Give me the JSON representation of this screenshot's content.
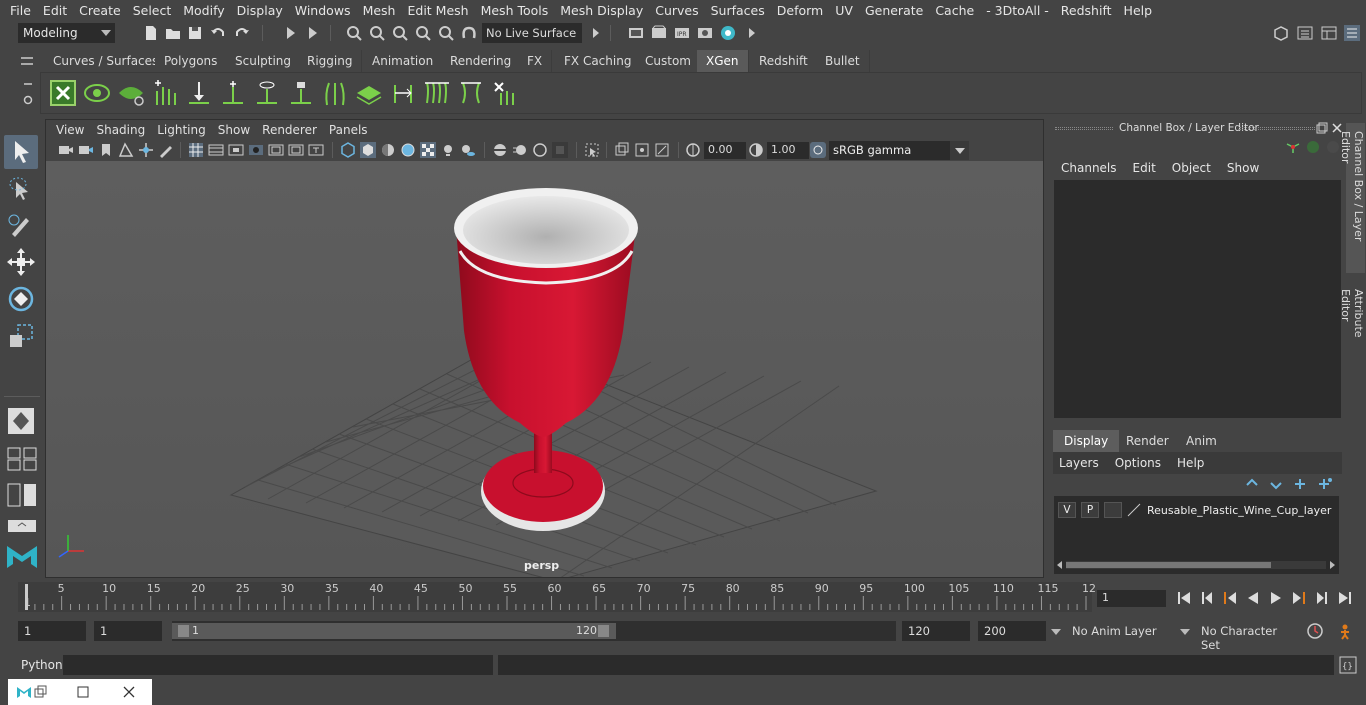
{
  "menubar": {
    "items": [
      "File",
      "Edit",
      "Create",
      "Select",
      "Modify",
      "Display",
      "Windows",
      "Mesh",
      "Edit Mesh",
      "Mesh Tools",
      "Mesh Display",
      "Curves",
      "Surfaces",
      "Deform",
      "UV",
      "Generate",
      "Cache",
      "- 3DtoAll -",
      "Redshift",
      "Help"
    ]
  },
  "statusline": {
    "mode": "Modeling",
    "live_surface": "No Live Surface"
  },
  "shelf": {
    "tabs": [
      "Curves / Surfaces",
      "Polygons",
      "Sculpting",
      "Rigging",
      "Animation",
      "Rendering",
      "FX",
      "FX Caching",
      "Custom",
      "XGen",
      "Redshift",
      "Bullet"
    ],
    "active_tab": "XGen"
  },
  "viewport": {
    "menus": [
      "View",
      "Shading",
      "Lighting",
      "Show",
      "Renderer",
      "Panels"
    ],
    "exposure": "0.00",
    "gamma": "1.00",
    "color_space": "sRGB gamma",
    "camera": "persp"
  },
  "right_panel": {
    "title": "Channel Box / Layer Editor",
    "menus": [
      "Channels",
      "Edit",
      "Object",
      "Show"
    ],
    "layer_tabs": [
      "Display",
      "Render",
      "Anim"
    ],
    "active_layer_tab": "Display",
    "layer_menus": [
      "Layers",
      "Options",
      "Help"
    ],
    "layer": {
      "v": "V",
      "p": "P",
      "name": "Reusable_Plastic_Wine_Cup_layer"
    }
  },
  "side_tabs": [
    "Channel Box / Layer Editor",
    "Attribute Editor"
  ],
  "timeline": {
    "ticks": [
      "5",
      "10",
      "15",
      "20",
      "25",
      "30",
      "35",
      "40",
      "45",
      "50",
      "55",
      "60",
      "65",
      "70",
      "75",
      "80",
      "85",
      "90",
      "95",
      "100",
      "105",
      "110",
      "115",
      "12"
    ],
    "start_label": "1",
    "current_frame": "1"
  },
  "range": {
    "start": "1",
    "playback_start": "1",
    "slider_start": "1",
    "slider_end": "120",
    "end": "120",
    "anim_end": "200",
    "anim_layer": "No Anim Layer",
    "character_set": "No Character Set"
  },
  "cmdline": {
    "label": "Python"
  },
  "colors": {
    "accent": "#5b6c7d",
    "cup_red": "#c8102e",
    "field": "#2b2b2b"
  }
}
